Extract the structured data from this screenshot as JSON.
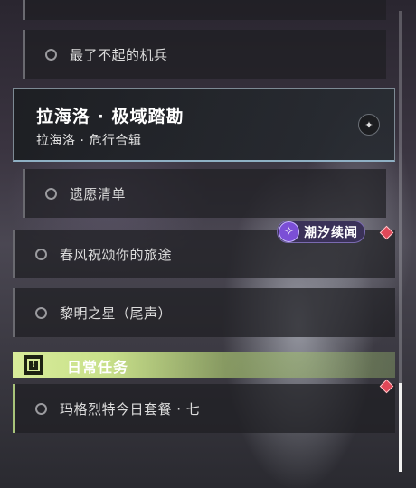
{
  "quests_top": [
    {
      "label": ""
    },
    {
      "label": "最了不起的机兵"
    }
  ],
  "header": {
    "title": "拉海洛 · 极域踏勘",
    "subtitle": "拉海洛 · 危行合辑",
    "mark_icon": "star-compass-icon"
  },
  "quests_mid": [
    {
      "label": "遗愿清单"
    },
    {
      "label": "春风祝颂你的旅途"
    },
    {
      "label": "黎明之星（尾声）"
    }
  ],
  "badge": {
    "label": "潮汐续闻",
    "icon": "tidal-swirl-icon",
    "color": "#7b4fd6"
  },
  "daily": {
    "label": "日常任务",
    "icon": "exclamation-icon",
    "color": "#d8ec9a"
  },
  "quests_daily": [
    {
      "label": "玛格烈特今日套餐 · 七"
    }
  ],
  "colors": {
    "diamond_marker": "#e04858"
  }
}
